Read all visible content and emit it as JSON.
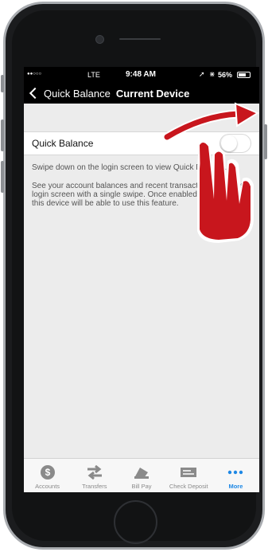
{
  "status_bar": {
    "carrier": "●●○○○",
    "network": "LTE",
    "time": "9:48 AM",
    "battery": "56%"
  },
  "nav": {
    "back_label": "Quick Balance",
    "title": "Current Device"
  },
  "setting": {
    "label": "Quick Balance",
    "toggle_on": false
  },
  "description": {
    "line1": "Swipe down on the login screen to view Quick Balance.",
    "line2": "See your account balances and recent transactions from the login screen with a single swipe. Once enabled, any user of this device will be able to use this feature."
  },
  "tabs": [
    {
      "label": "Accounts",
      "icon": "dollar-coin-icon"
    },
    {
      "label": "Transfers",
      "icon": "transfer-arrows-icon"
    },
    {
      "label": "Bill Pay",
      "icon": "bill-pay-icon"
    },
    {
      "label": "Check Deposit",
      "icon": "check-deposit-icon"
    },
    {
      "label": "More",
      "icon": "more-dots-icon"
    }
  ],
  "colors": {
    "accent": "#1e88e5",
    "overlay_red": "#c8161d"
  }
}
